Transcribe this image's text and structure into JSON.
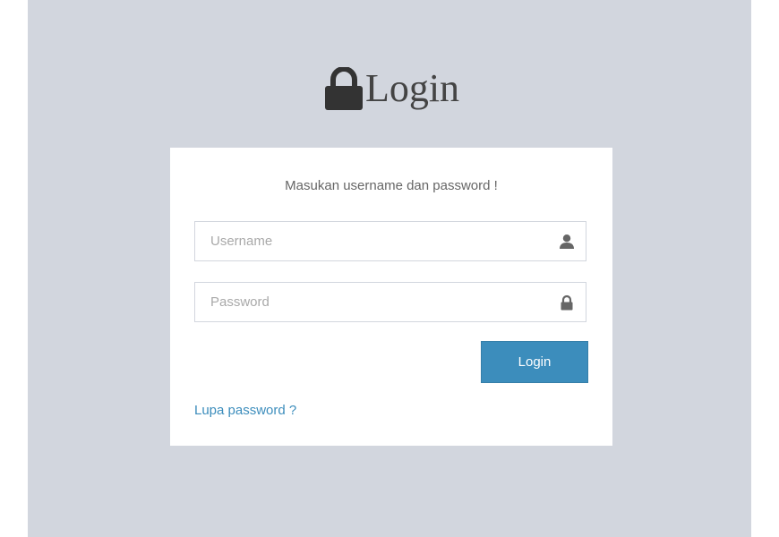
{
  "header": {
    "title": "Login"
  },
  "login_box": {
    "message": "Masukan username dan password !",
    "username": {
      "placeholder": "Username",
      "value": "",
      "icon": "user-icon"
    },
    "password": {
      "placeholder": "Password",
      "value": "",
      "icon": "lock-icon"
    },
    "submit_label": "Login",
    "forgot_label": "Lupa password ?"
  },
  "colors": {
    "page_background": "#d2d6de",
    "box_background": "#ffffff",
    "accent": "#3c8dbc",
    "link": "#3c8dbc",
    "icon": "#666666"
  }
}
